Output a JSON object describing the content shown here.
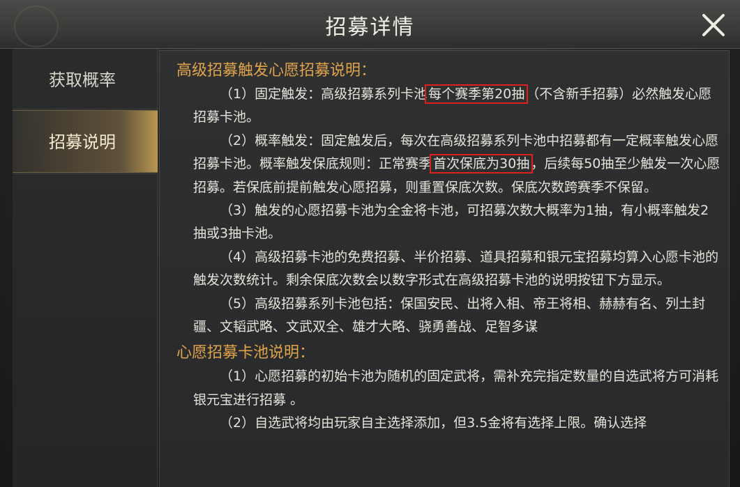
{
  "window": {
    "title": "招募详情",
    "close_icon": "close-icon"
  },
  "sidebar": {
    "items": [
      {
        "label": "获取概率",
        "selected": false
      },
      {
        "label": "招募说明",
        "selected": true
      }
    ]
  },
  "content": {
    "section1": {
      "title": "高级招募触发心愿招募说明：",
      "p1": {
        "pre": "（1）固定触发：高级招募系列卡池",
        "hl": "每个赛季第20抽",
        "post": "（不含新手招募）必然触发心愿招募卡池。"
      },
      "p2": {
        "pre": "（2）概率触发：固定触发后，每次在高级招募系列卡池中招募都有一定概率触发心愿招募卡池。概率触发保底规则：正常赛季",
        "hl": "首次保底为30抽",
        "post": "，后续每50抽至少触发一次心愿招募。若保底前提前触发心愿招募，则重置保底次数。保底次数跨赛季不保留。"
      },
      "p3": "（3）触发的心愿招募卡池为全金将卡池，可招募次数大概率为1抽，有小概率触发2抽或3抽卡池。",
      "p4": "（4）高级招募卡池的免费招募、半价招募、道具招募和银元宝招募均算入心愿卡池的触发次数统计。剩余保底次数会以数字形式在高级招募卡池的说明按钮下方显示。",
      "p5": "（5）高级招募系列卡池包括：保国安民、出将入相、帝王将相、赫赫有名、列土封疆、文韬武略、文武双全、雄才大略、骁勇善战、足智多谋"
    },
    "section2": {
      "title": "心愿招募卡池说明：",
      "p1": "（1）心愿招募的初始卡池为随机的固定武将，需补充完指定数量的自选武将方可消耗银元宝进行招募 。",
      "p2": "（2）自选武将均由玩家自主选择添加，但3.5金将有选择上限。确认选择"
    }
  },
  "colors": {
    "section_title": "#e0a44a",
    "body_text": "#e6e3da",
    "highlight_box": "#e0201c",
    "selected_tab": "#d2aa5a"
  }
}
